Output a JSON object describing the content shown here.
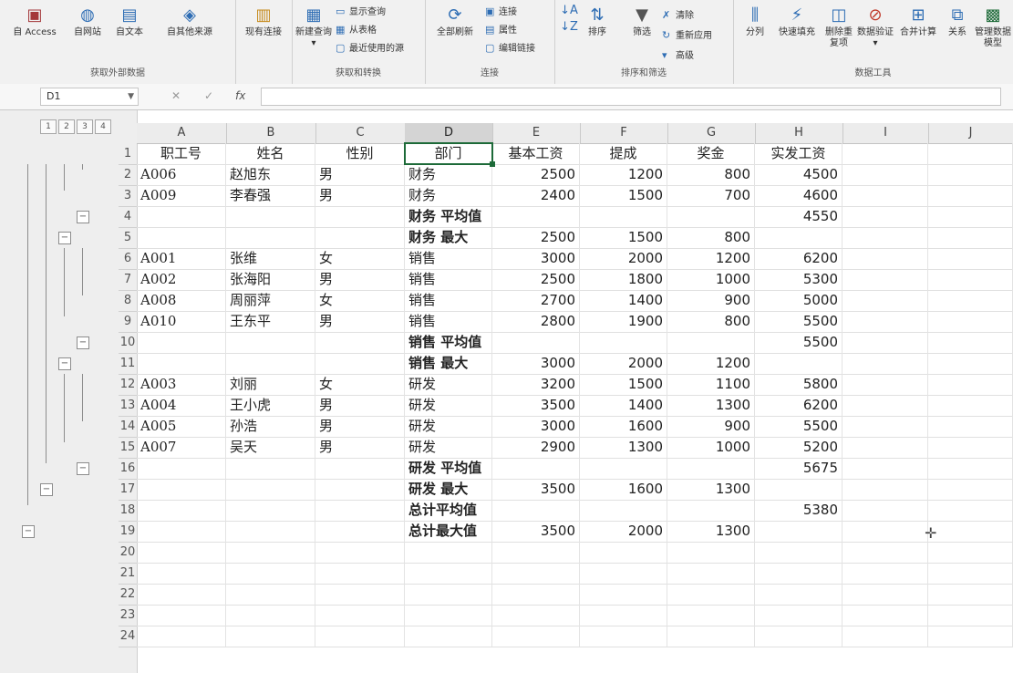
{
  "ribbon": {
    "get_external": {
      "label": "获取外部数据",
      "buttons": [
        "自 Access",
        "自网站",
        "自文本",
        "自其他来源"
      ]
    },
    "existing_conn": "现有连接",
    "get_transform": {
      "label": "获取和转换",
      "new_query": "新建查询",
      "new_query_arrow": "▾",
      "small": [
        "显示查询",
        "从表格",
        "最近使用的源"
      ]
    },
    "connections": {
      "label": "连接",
      "refresh_all": "全部刷新",
      "small": [
        "连接",
        "属性",
        "编辑链接"
      ]
    },
    "sort_filter": {
      "label": "排序和筛选",
      "sort": "排序",
      "filter": "筛选",
      "small": [
        "清除",
        "重新应用",
        "高级"
      ]
    },
    "data_tools": {
      "label": "数据工具",
      "buttons": [
        "分列",
        "快速填充",
        "删除重复项",
        "数据验证",
        "合并计算",
        "关系",
        "管理数据模型"
      ],
      "validation_arrow": "▾"
    },
    "colors": {
      "accent": "#2e6db4",
      "ribbon_bg": "#f1f1f1"
    }
  },
  "formula_bar": {
    "name_box": "D1",
    "cancel": "✕",
    "enter": "✓",
    "fx": "fx",
    "value": ""
  },
  "grid": {
    "outline_levels": [
      "1",
      "2",
      "3",
      "4"
    ],
    "outline_minus": "−",
    "columns": [
      "A",
      "B",
      "C",
      "D",
      "E",
      "F",
      "G",
      "H",
      "I",
      "J"
    ],
    "selected_column": "D",
    "active_cell": "D1",
    "rows": [
      {
        "n": "1",
        "cells": [
          "职工号",
          "姓名",
          "性别",
          "部门",
          "基本工资",
          "提成",
          "奖金",
          "实发工资"
        ]
      },
      {
        "n": "2",
        "cells": [
          "A006",
          "赵旭东",
          "男",
          "财务",
          "2500",
          "1200",
          "800",
          "4500"
        ]
      },
      {
        "n": "3",
        "cells": [
          "A009",
          "李春强",
          "男",
          "财务",
          "2400",
          "1500",
          "700",
          "4600"
        ]
      },
      {
        "n": "4",
        "cells": [
          "",
          "",
          "",
          "财务 平均值",
          "",
          "",
          "",
          "4550"
        ]
      },
      {
        "n": "5",
        "cells": [
          "",
          "",
          "",
          "财务 最大",
          "2500",
          "1500",
          "800",
          ""
        ]
      },
      {
        "n": "6",
        "cells": [
          "A001",
          "张维",
          "女",
          "销售",
          "3000",
          "2000",
          "1200",
          "6200"
        ]
      },
      {
        "n": "7",
        "cells": [
          "A002",
          "张海阳",
          "男",
          "销售",
          "2500",
          "1800",
          "1000",
          "5300"
        ]
      },
      {
        "n": "8",
        "cells": [
          "A008",
          "周丽萍",
          "女",
          "销售",
          "2700",
          "1400",
          "900",
          "5000"
        ]
      },
      {
        "n": "9",
        "cells": [
          "A010",
          "王东平",
          "男",
          "销售",
          "2800",
          "1900",
          "800",
          "5500"
        ]
      },
      {
        "n": "10",
        "cells": [
          "",
          "",
          "",
          "销售 平均值",
          "",
          "",
          "",
          "5500"
        ]
      },
      {
        "n": "11",
        "cells": [
          "",
          "",
          "",
          "销售 最大",
          "3000",
          "2000",
          "1200",
          ""
        ]
      },
      {
        "n": "12",
        "cells": [
          "A003",
          "刘丽",
          "女",
          "研发",
          "3200",
          "1500",
          "1100",
          "5800"
        ]
      },
      {
        "n": "13",
        "cells": [
          "A004",
          "王小虎",
          "男",
          "研发",
          "3500",
          "1400",
          "1300",
          "6200"
        ]
      },
      {
        "n": "14",
        "cells": [
          "A005",
          "孙浩",
          "男",
          "研发",
          "3000",
          "1600",
          "900",
          "5500"
        ]
      },
      {
        "n": "15",
        "cells": [
          "A007",
          "吴天",
          "男",
          "研发",
          "2900",
          "1300",
          "1000",
          "5200"
        ]
      },
      {
        "n": "16",
        "cells": [
          "",
          "",
          "",
          "研发 平均值",
          "",
          "",
          "",
          "5675"
        ]
      },
      {
        "n": "17",
        "cells": [
          "",
          "",
          "",
          "研发 最大",
          "3500",
          "1600",
          "1300",
          ""
        ]
      },
      {
        "n": "18",
        "cells": [
          "",
          "",
          "",
          "总计平均值",
          "",
          "",
          "",
          "5380"
        ]
      },
      {
        "n": "19",
        "cells": [
          "",
          "",
          "",
          "总计最大值",
          "3500",
          "2000",
          "1300",
          ""
        ]
      },
      {
        "n": "20",
        "cells": [
          "",
          "",
          "",
          "",
          "",
          "",
          "",
          ""
        ]
      },
      {
        "n": "21",
        "cells": [
          "",
          "",
          "",
          "",
          "",
          "",
          "",
          ""
        ]
      },
      {
        "n": "22",
        "cells": [
          "",
          "",
          "",
          "",
          "",
          "",
          "",
          ""
        ]
      },
      {
        "n": "23",
        "cells": [
          "",
          "",
          "",
          "",
          "",
          "",
          "",
          ""
        ]
      },
      {
        "n": "24",
        "cells": [
          "",
          "",
          "",
          "",
          "",
          "",
          "",
          ""
        ]
      }
    ],
    "colors": {
      "selection": "#1d6a38",
      "header_bg": "#ececec"
    }
  }
}
